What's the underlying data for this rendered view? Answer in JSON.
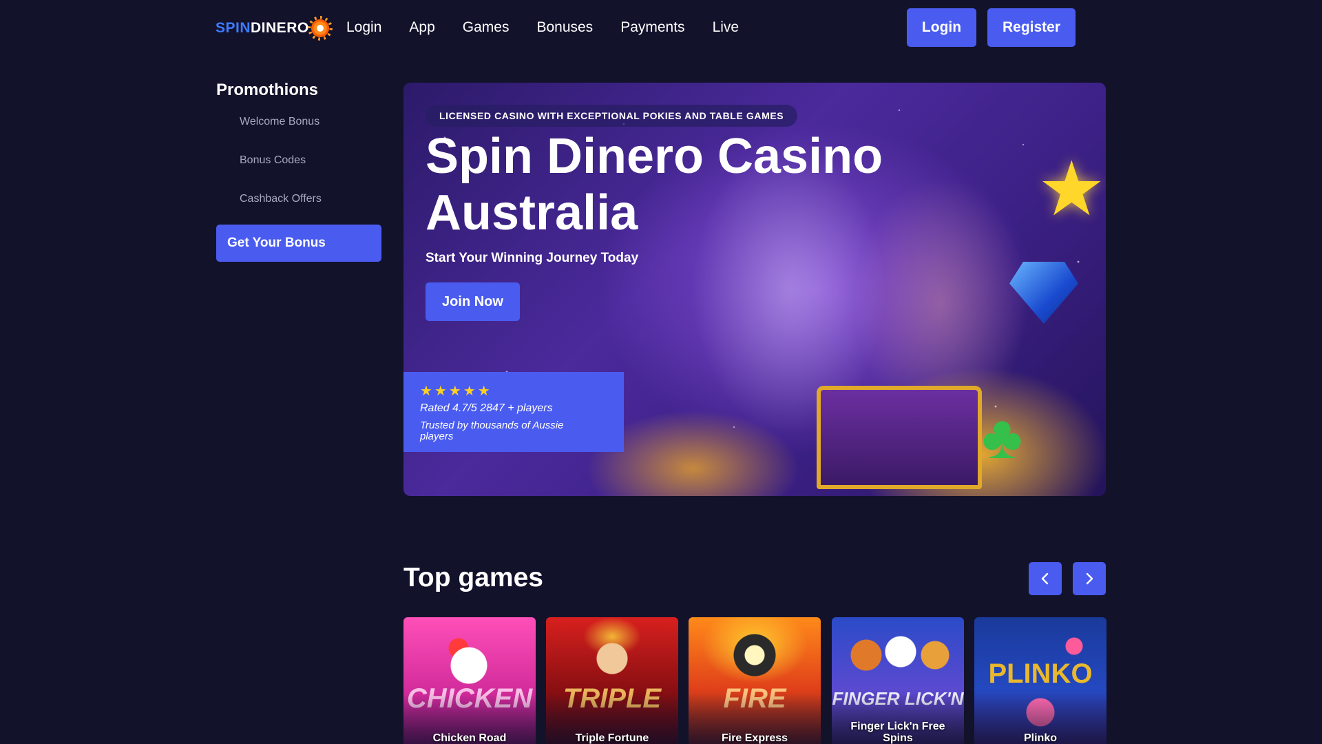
{
  "header": {
    "logo": {
      "spin": "SPIN",
      "dinero": "DINERO"
    },
    "nav": [
      "Login",
      "App",
      "Games",
      "Bonuses",
      "Payments",
      "Live"
    ],
    "login_label": "Login",
    "register_label": "Register"
  },
  "sidebar": {
    "title": "Promothions",
    "items": [
      "Welcome Bonus",
      "Bonus Codes",
      "Cashback Offers"
    ],
    "cta_label": "Get Your Bonus"
  },
  "hero": {
    "badge": "LICENSED CASINO WITH EXCEPTIONAL POKIES AND TABLE GAMES",
    "title": "Spin Dinero Casino Australia",
    "subtitle": "Start Your Winning Journey Today",
    "join_label": "Join Now",
    "rating": {
      "stars": "★★★★★",
      "rating_text": "Rated 4.7/5",
      "players_text": "2847 + players",
      "trust_text": "Trusted by thousands of Aussie players"
    }
  },
  "top_games": {
    "title": "Top games",
    "games": [
      {
        "name": "Chicken Road",
        "art_word": "CHICKEN"
      },
      {
        "name": "Triple Fortune",
        "art_word": "TRIPLE"
      },
      {
        "name": "Fire Express",
        "art_word": "FIRE"
      },
      {
        "name": "Finger Lick'n Free Spins",
        "art_word": "FINGER LICK'N"
      },
      {
        "name": "Plinko",
        "art_word": "PLINKO"
      }
    ]
  },
  "colors": {
    "background": "#13122b",
    "accent": "#4a5cf0",
    "star": "#ffd21f"
  }
}
